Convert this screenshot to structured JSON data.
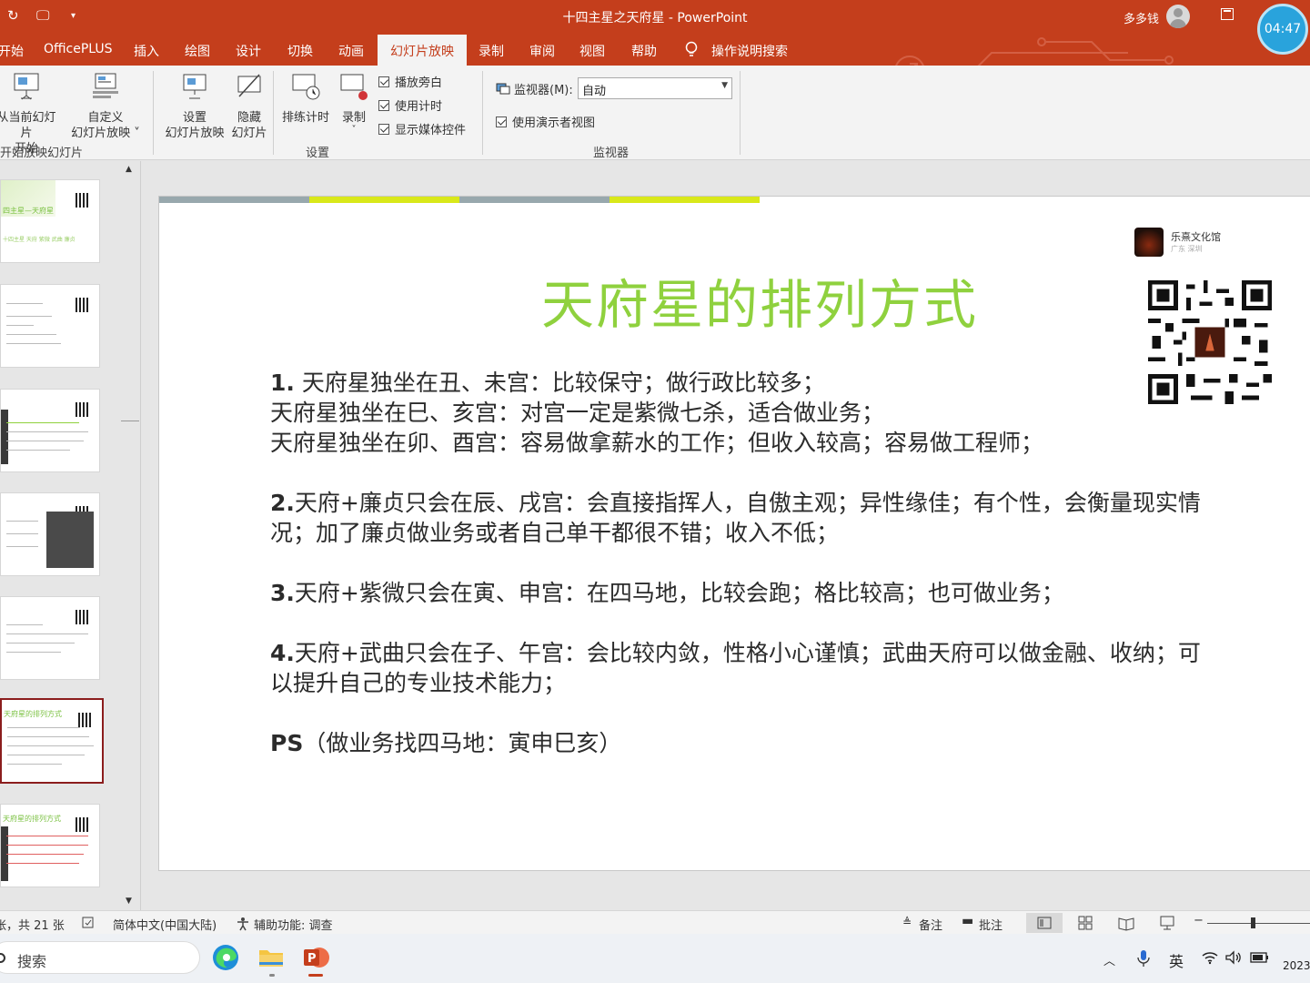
{
  "window": {
    "doc_title": "十四主星之天府星 - PowerPoint",
    "user": "多多钱",
    "clock": "04:47"
  },
  "tabs": [
    {
      "label": "开始"
    },
    {
      "label": "OfficePLUS"
    },
    {
      "label": "插入"
    },
    {
      "label": "绘图"
    },
    {
      "label": "设计"
    },
    {
      "label": "切换"
    },
    {
      "label": "动画"
    },
    {
      "label": "幻灯片放映"
    },
    {
      "label": "录制"
    },
    {
      "label": "审阅"
    },
    {
      "label": "视图"
    },
    {
      "label": "帮助"
    },
    {
      "label": "操作说明搜索"
    }
  ],
  "ribbon": {
    "from_current": [
      "从当前幻灯片",
      "开始"
    ],
    "custom_show": [
      "自定义",
      "幻灯片放映 ˅"
    ],
    "group_start": "开始放映幻灯片",
    "setup_show": [
      "设置",
      "幻灯片放映"
    ],
    "hide_slide": [
      "隐藏",
      "幻灯片"
    ],
    "rehearse": "排练计时",
    "record": [
      "录制",
      "˅"
    ],
    "chk_narration": "播放旁白",
    "chk_timing": "使用计时",
    "chk_media": "显示媒体控件",
    "group_setup": "设置",
    "monitor_label": "监视器(M):",
    "monitor_value": "自动",
    "chk_presenter": "使用演示者视图",
    "group_monitor": "监视器"
  },
  "thumbnails": [
    {
      "title": "四主星—天府星",
      "sub": "十四主星 天府 紫微 武曲 廉贞"
    },
    {
      "title": "",
      "sub": ""
    },
    {
      "title": "",
      "sub": ""
    },
    {
      "title": "",
      "sub": ""
    },
    {
      "title": "",
      "sub": ""
    },
    {
      "title": "天府星的排列方式",
      "sub": ""
    },
    {
      "title": "天府星的排列方式",
      "sub": ""
    }
  ],
  "slide": {
    "title": "天府星的排列方式",
    "logo_name": "乐熹文化馆",
    "logo_sub": "广东 深圳",
    "lines": [
      {
        "num": "1.",
        "text": " 天府星独坐在丑、未宫：比较保守；做行政比较多；"
      },
      {
        "num": "",
        "text": "  天府星独坐在巳、亥宫：对宫一定是紫微七杀，适合做业务；"
      },
      {
        "num": "",
        "text": "  天府星独坐在卯、酉宫：容易做拿薪水的工作；但收入较高；容易做工程师；"
      },
      {
        "num": "2.",
        "text": "天府+廉贞只会在辰、戌宫：会直接指挥人，自傲主观；异性缘佳；有个性，会衡量现实情"
      },
      {
        "num": "",
        "text": "况；加了廉贞做业务或者自己单干都很不错；收入不低；"
      },
      {
        "num": "3.",
        "text": "天府+紫微只会在寅、申宫：在四马地，比较会跑；格比较高；也可做业务；"
      },
      {
        "num": "4.",
        "text": "天府+武曲只会在子、午宫：会比较内敛，性格小心谨慎；武曲天府可以做金融、收纳；可"
      },
      {
        "num": "",
        "text": "以提升自己的专业技术能力；"
      },
      {
        "num": "PS",
        "text": "（做业务找四马地：寅申巳亥）"
      }
    ]
  },
  "status": {
    "slide_count": "张，共 21 张",
    "language": "简体中文(中国大陆)",
    "accessibility": "辅助功能: 调查",
    "notes": "备注",
    "comments": "批注"
  },
  "taskbar": {
    "search": "搜索",
    "ime": "英",
    "date": "2023"
  },
  "colors": {
    "accent": "#c43e1c",
    "title_green": "#8fd13e",
    "bar_gray": "#98a8ad",
    "bar_yellow": "#d9e81a",
    "selected_border": "#8b1d1d"
  }
}
